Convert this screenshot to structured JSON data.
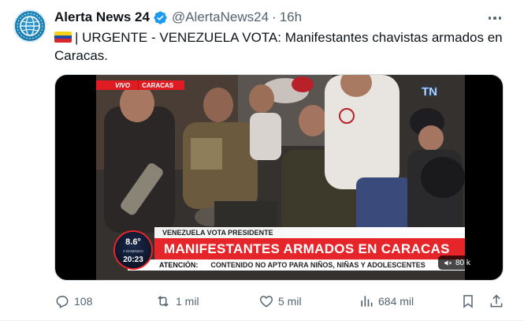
{
  "tweet": {
    "author": {
      "display_name": "Alerta News 24",
      "handle": "@AlertaNews24",
      "verified": true,
      "avatar_icon": "globe-logo-icon"
    },
    "separator": "·",
    "time": "16h",
    "text": "| URGENTE - VENEZUELA VOTA: Manifestantes chavistas armados en Caracas.",
    "flag_icon": "venezuela-flag-icon",
    "media": {
      "broadcast": {
        "live_label": "VIVO",
        "location_label": "CARACAS",
        "channel_logo": "TN",
        "subtitle": "VENEZUELA VOTA PRESIDENTE",
        "headline": "MANIFESTANTES ARMADOS EN CARACAS",
        "ticker_label": "ATENCIÓN:",
        "ticker_text": "CONTENIDO NO APTO PARA NIÑOS, NIÑAS Y ADOLESCENTES",
        "temperature": "8.6°",
        "clock_date": "2 DOMINGO",
        "clock_time": "20:23"
      },
      "views": "80 k"
    },
    "actions": {
      "replies": "108",
      "reposts": "1 mil",
      "likes": "5 mil",
      "views": "684 mil"
    }
  },
  "colors": {
    "text_primary": "#0f1419",
    "text_secondary": "#536471",
    "verified_blue": "#1d9bf0",
    "broadcast_red": "#e5252a"
  }
}
